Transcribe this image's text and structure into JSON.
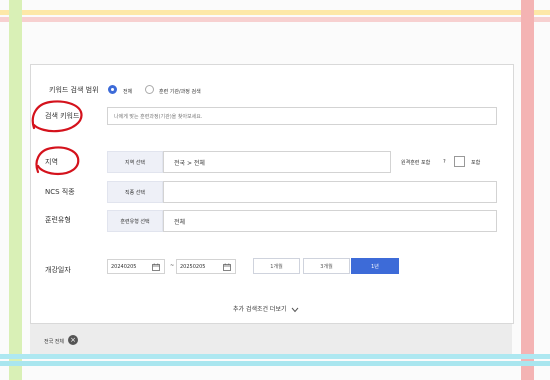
{
  "form": {
    "keyword_scope_label": "키워드 검색 범위",
    "scope_all": "전체",
    "scope_course": "훈련 기관/과정 검색",
    "keyword_label": "검색 키워드",
    "keyword_placeholder": "나에게 맞는 훈련과정(기관)을 찾아보세요.",
    "region_label": "지역",
    "region_button": "지역 선택",
    "region_value": "전국 > 전체",
    "remote_label": "원격훈련 포함",
    "help_mark": "?",
    "include_label": "포함",
    "ncs_label": "NCS 직종",
    "ncs_button": "직종 선택",
    "ncs_value": "",
    "type_label": "훈련유형",
    "type_button": "훈련유형 선택",
    "type_value": "전체",
    "date_label": "개강일자",
    "start_date": "20240205",
    "end_date": "20250205",
    "date_sep": "~",
    "period_1m": "1개월",
    "period_3m": "3개월",
    "period_1y": "1년",
    "more_label": "추가 검색조건 더보기"
  },
  "footer": {
    "chip_label": "전국 전체"
  },
  "colors": {
    "accent": "#3d6bd8",
    "annotation": "#d4121c"
  }
}
